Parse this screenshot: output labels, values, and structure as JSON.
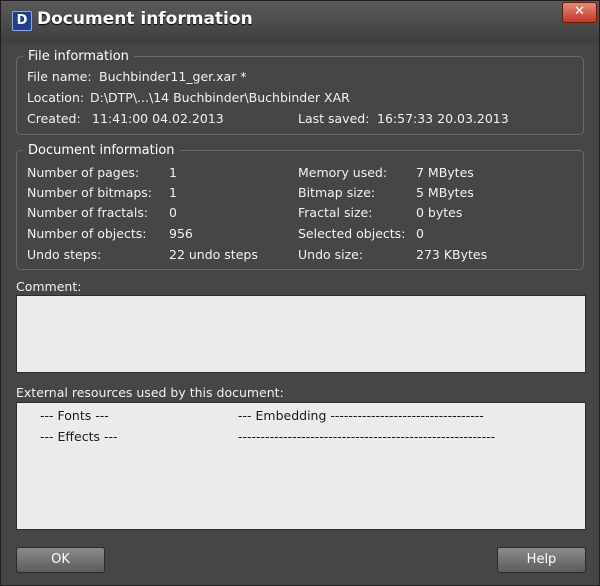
{
  "window": {
    "title": "Document information",
    "icon_letter": "D",
    "close_glyph": "✕",
    "colors": {
      "background": "#464646",
      "close": "#c03a22",
      "textbox": "#ebebeb"
    }
  },
  "file_info": {
    "legend": "File information",
    "file_name_label": "File name:",
    "file_name_value": "Buchbinder11_ger.xar *",
    "location_label": "Location:",
    "location_value": "D:\\DTP\\...\\14 Buchbinder\\Buchbinder XAR",
    "created_label": "Created:",
    "created_value": "11:41:00  04.02.2013",
    "last_saved_label": "Last saved:",
    "last_saved_value": "16:57:33  20.03.2013"
  },
  "doc_info": {
    "legend": "Document information",
    "left": [
      {
        "label": "Number of pages:",
        "value": "1"
      },
      {
        "label": "Number of bitmaps:",
        "value": "1"
      },
      {
        "label": "Number of fractals:",
        "value": "0"
      },
      {
        "label": "Number of objects:",
        "value": "956"
      },
      {
        "label": "Undo steps:",
        "value": "22 undo steps"
      }
    ],
    "right": [
      {
        "label": "Memory used:",
        "value": "7 MBytes"
      },
      {
        "label": "Bitmap size:",
        "value": "5 MBytes"
      },
      {
        "label": "Fractal size:",
        "value": "0 bytes"
      },
      {
        "label": "Selected objects:",
        "value": "0"
      },
      {
        "label": "Undo size:",
        "value": "273 KBytes"
      }
    ]
  },
  "comment": {
    "label": "Comment:",
    "value": ""
  },
  "resources": {
    "label": "External resources used by this document:",
    "rows": [
      {
        "name": "--- Fonts ---",
        "detail": "--- Embedding ----------------------------------"
      },
      {
        "name": "--- Effects ---",
        "detail": "---------------------------------------------------------"
      }
    ]
  },
  "buttons": {
    "ok": "OK",
    "help": "Help"
  }
}
